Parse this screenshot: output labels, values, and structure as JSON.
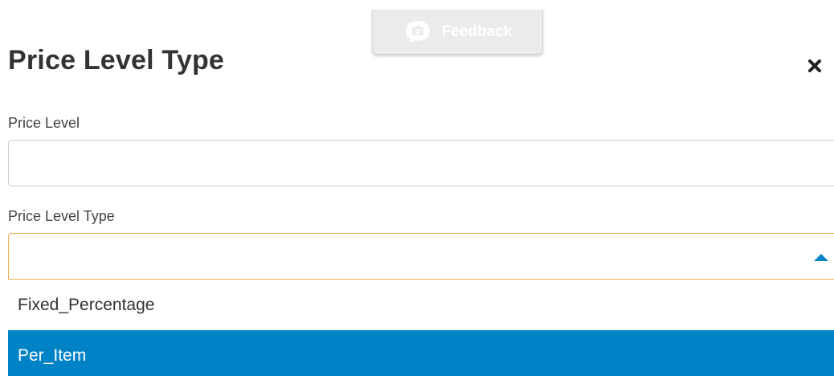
{
  "feedback": {
    "label": "Feedback",
    "icon": "camera-speech-icon"
  },
  "dialog": {
    "title": "Price Level Type",
    "close_icon": "close-icon"
  },
  "form": {
    "price_level": {
      "label": "Price Level",
      "value": "",
      "placeholder": ""
    },
    "price_level_type": {
      "label": "Price Level Type",
      "selected_value": "",
      "arrow_icon": "caret-up-icon",
      "options": [
        {
          "label": "Fixed_Percentage",
          "highlighted": false
        },
        {
          "label": "Per_Item",
          "highlighted": true
        }
      ]
    }
  },
  "colors": {
    "title_text": "#333333",
    "label_text": "#444444",
    "input_border": "#cccccc",
    "focus_border": "#f0ad4e",
    "highlight_bg": "#0082c6",
    "highlight_text": "#ffffff",
    "feedback_bg": "#ebebeb",
    "arrow": "#0082c6"
  }
}
